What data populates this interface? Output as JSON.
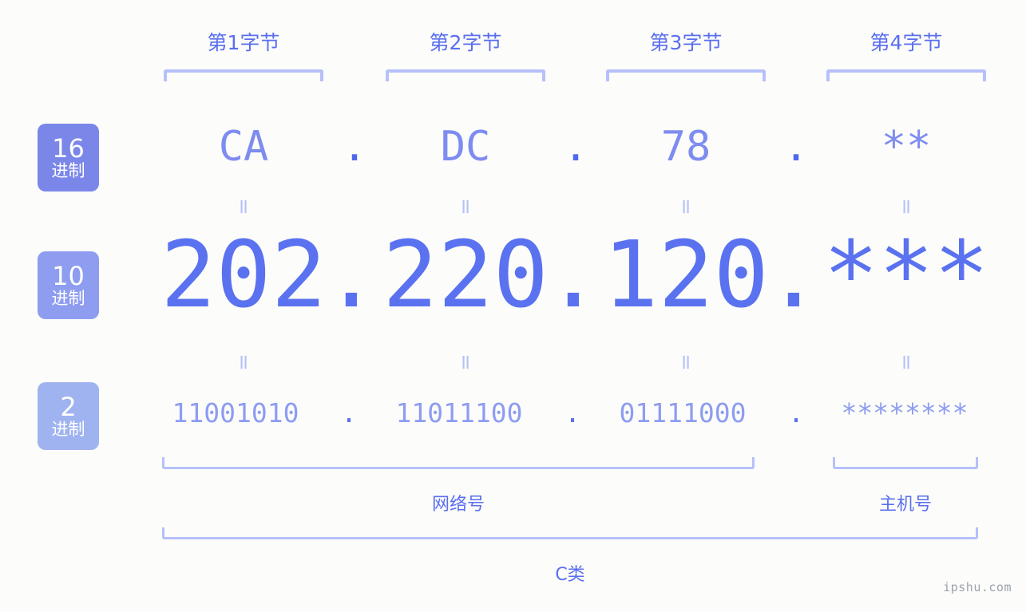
{
  "meta": {
    "watermark": "ipshu.com",
    "background_color": "#fcfdfa",
    "accent_color": "#5a72f0",
    "light_accent_color": "#b6c0fb"
  },
  "byte_headers": [
    {
      "label": "第1字节"
    },
    {
      "label": "第2字节"
    },
    {
      "label": "第3字节"
    },
    {
      "label": "第4字节"
    }
  ],
  "radix_badges": [
    {
      "num": "16",
      "sub": "进制",
      "color": "#7b87e8"
    },
    {
      "num": "10",
      "sub": "进制",
      "color": "#8e9df0"
    },
    {
      "num": "2",
      "sub": "进制",
      "color": "#9fb3f0"
    }
  ],
  "rows": {
    "hex": {
      "radix": "16",
      "values": [
        "CA",
        "DC",
        "78",
        "**"
      ],
      "separator": "."
    },
    "decimal": {
      "radix": "10",
      "values": [
        "202",
        "220",
        "120",
        "***"
      ],
      "separator": "."
    },
    "binary": {
      "radix": "2",
      "values": [
        "11001010",
        "11011100",
        "01111000",
        "********"
      ],
      "separator": "."
    }
  },
  "equals_marks": {
    "symbol": "=",
    "count_per_row": 4
  },
  "sections": [
    {
      "label": "网络号"
    },
    {
      "label": "主机号"
    }
  ],
  "ip_class": {
    "label": "C类"
  }
}
